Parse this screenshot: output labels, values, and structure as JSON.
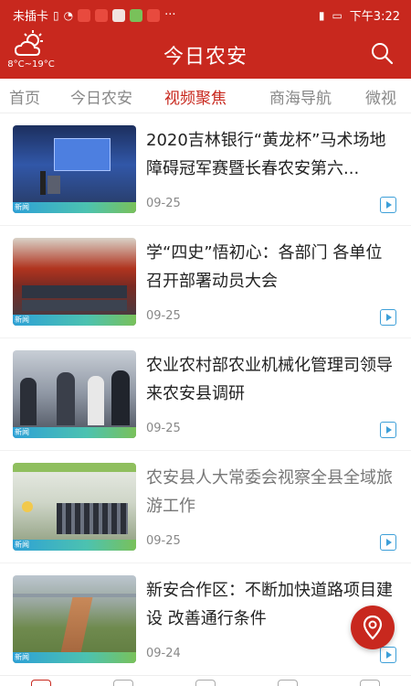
{
  "status_bar": {
    "carrier": "未插卡",
    "time": "下午3:22",
    "dots": "···"
  },
  "header": {
    "title": "今日农安",
    "weather_temp": "8°C~19°C"
  },
  "tabs": [
    {
      "label": "首页",
      "active": false
    },
    {
      "label": "今日农安",
      "active": false
    },
    {
      "label": "视频聚焦",
      "active": true
    },
    {
      "label": "商海导航",
      "active": false
    },
    {
      "label": "微视",
      "active": false
    }
  ],
  "articles": [
    {
      "title": "2020吉林银行“黄龙杯”马术场地障碍冠军赛暨长春农安第六...",
      "date": "09-25",
      "tag": "新闻",
      "muted": false
    },
    {
      "title": "学“四史”悟初心：各部门 各单位召开部署动员大会",
      "date": "09-25",
      "tag": "新闻",
      "muted": false
    },
    {
      "title": "农业农村部农业机械化管理司领导来农安县调研",
      "date": "09-25",
      "tag": "新闻",
      "muted": false
    },
    {
      "title": "农安县人大常委会视察全县全域旅游工作",
      "date": "09-25",
      "tag": "新闻",
      "muted": true
    },
    {
      "title": "新安合作区：不断加快道路项目建设 改善通行条件",
      "date": "09-24",
      "tag": "新闻",
      "muted": false
    }
  ],
  "colors": {
    "brand_red": "#c8281e",
    "active_tab": "#c8281e",
    "play_icon": "#3d9fd8"
  },
  "icons": {
    "weather": "cloud-sun-icon",
    "search": "search-icon",
    "play": "play-icon",
    "fab": "location-pin-icon"
  }
}
